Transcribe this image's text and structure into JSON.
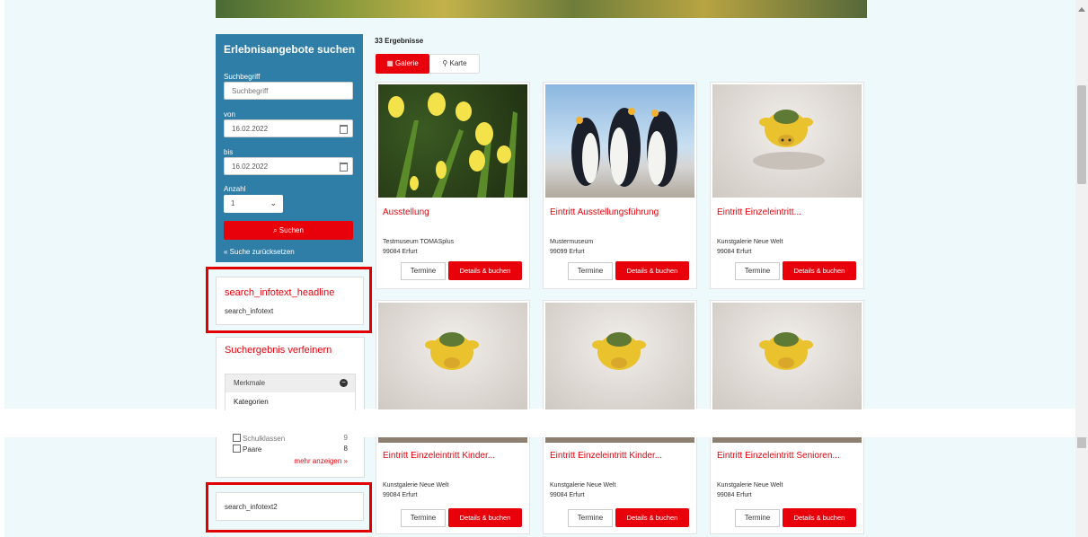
{
  "search": {
    "title": "Erlebnisangebote suchen",
    "term_label": "Suchbegriff",
    "term_placeholder": "Suchbegriff",
    "from_label": "von",
    "from_value": "16.02.2022",
    "to_label": "bis",
    "to_value": "16.02.2022",
    "count_label": "Anzahl",
    "count_value": "1",
    "submit_label": "Suchen",
    "reset_label": "« Suche zurücksetzen"
  },
  "info": {
    "headline": "search_infotext_headline",
    "text": "search_infotext",
    "text2": "search_infotext2"
  },
  "refine": {
    "title": "Suchergebnis verfeinern",
    "merkmale_label": "Merkmale",
    "kategorien_label": "Kategorien",
    "cut_row_label": "Schulklassen",
    "cut_row_count": "9",
    "filter_label": "Paare",
    "filter_count": "8",
    "more_label": "mehr anzeigen »"
  },
  "results_count": "33 Ergebnisse",
  "view_tabs": {
    "gallery": "Galerie",
    "map": "Karte"
  },
  "buttons": {
    "termine": "Termine",
    "book": "Details & buchen"
  },
  "cards": [
    {
      "title": "Ausstellung",
      "addr1": "Testmuseum TOMASplus",
      "addr2": "99084 Erfurt"
    },
    {
      "title": "Eintritt Ausstellungsführung",
      "addr1": "Mustermuseum",
      "addr2": "99099 Erfurt"
    },
    {
      "title": "Eintritt Einzeleintritt...",
      "addr1": "Kunstgalerie Neue Welt",
      "addr2": "99084 Erfurt"
    },
    {
      "title": "Eintritt Einzeleintritt Kinder...",
      "addr1": "Kunstgalerie Neue Welt",
      "addr2": "99084 Erfurt"
    },
    {
      "title": "Eintritt Einzeleintritt Kinder...",
      "addr1": "Kunstgalerie Neue Welt",
      "addr2": "99084 Erfurt"
    },
    {
      "title": "Eintritt Einzeleintritt Senioren...",
      "addr1": "Kunstgalerie Neue Welt",
      "addr2": "99084 Erfurt"
    }
  ],
  "colors": {
    "accent": "#e8000b",
    "panel": "#2f7ea8",
    "background": "#eef9fc"
  }
}
